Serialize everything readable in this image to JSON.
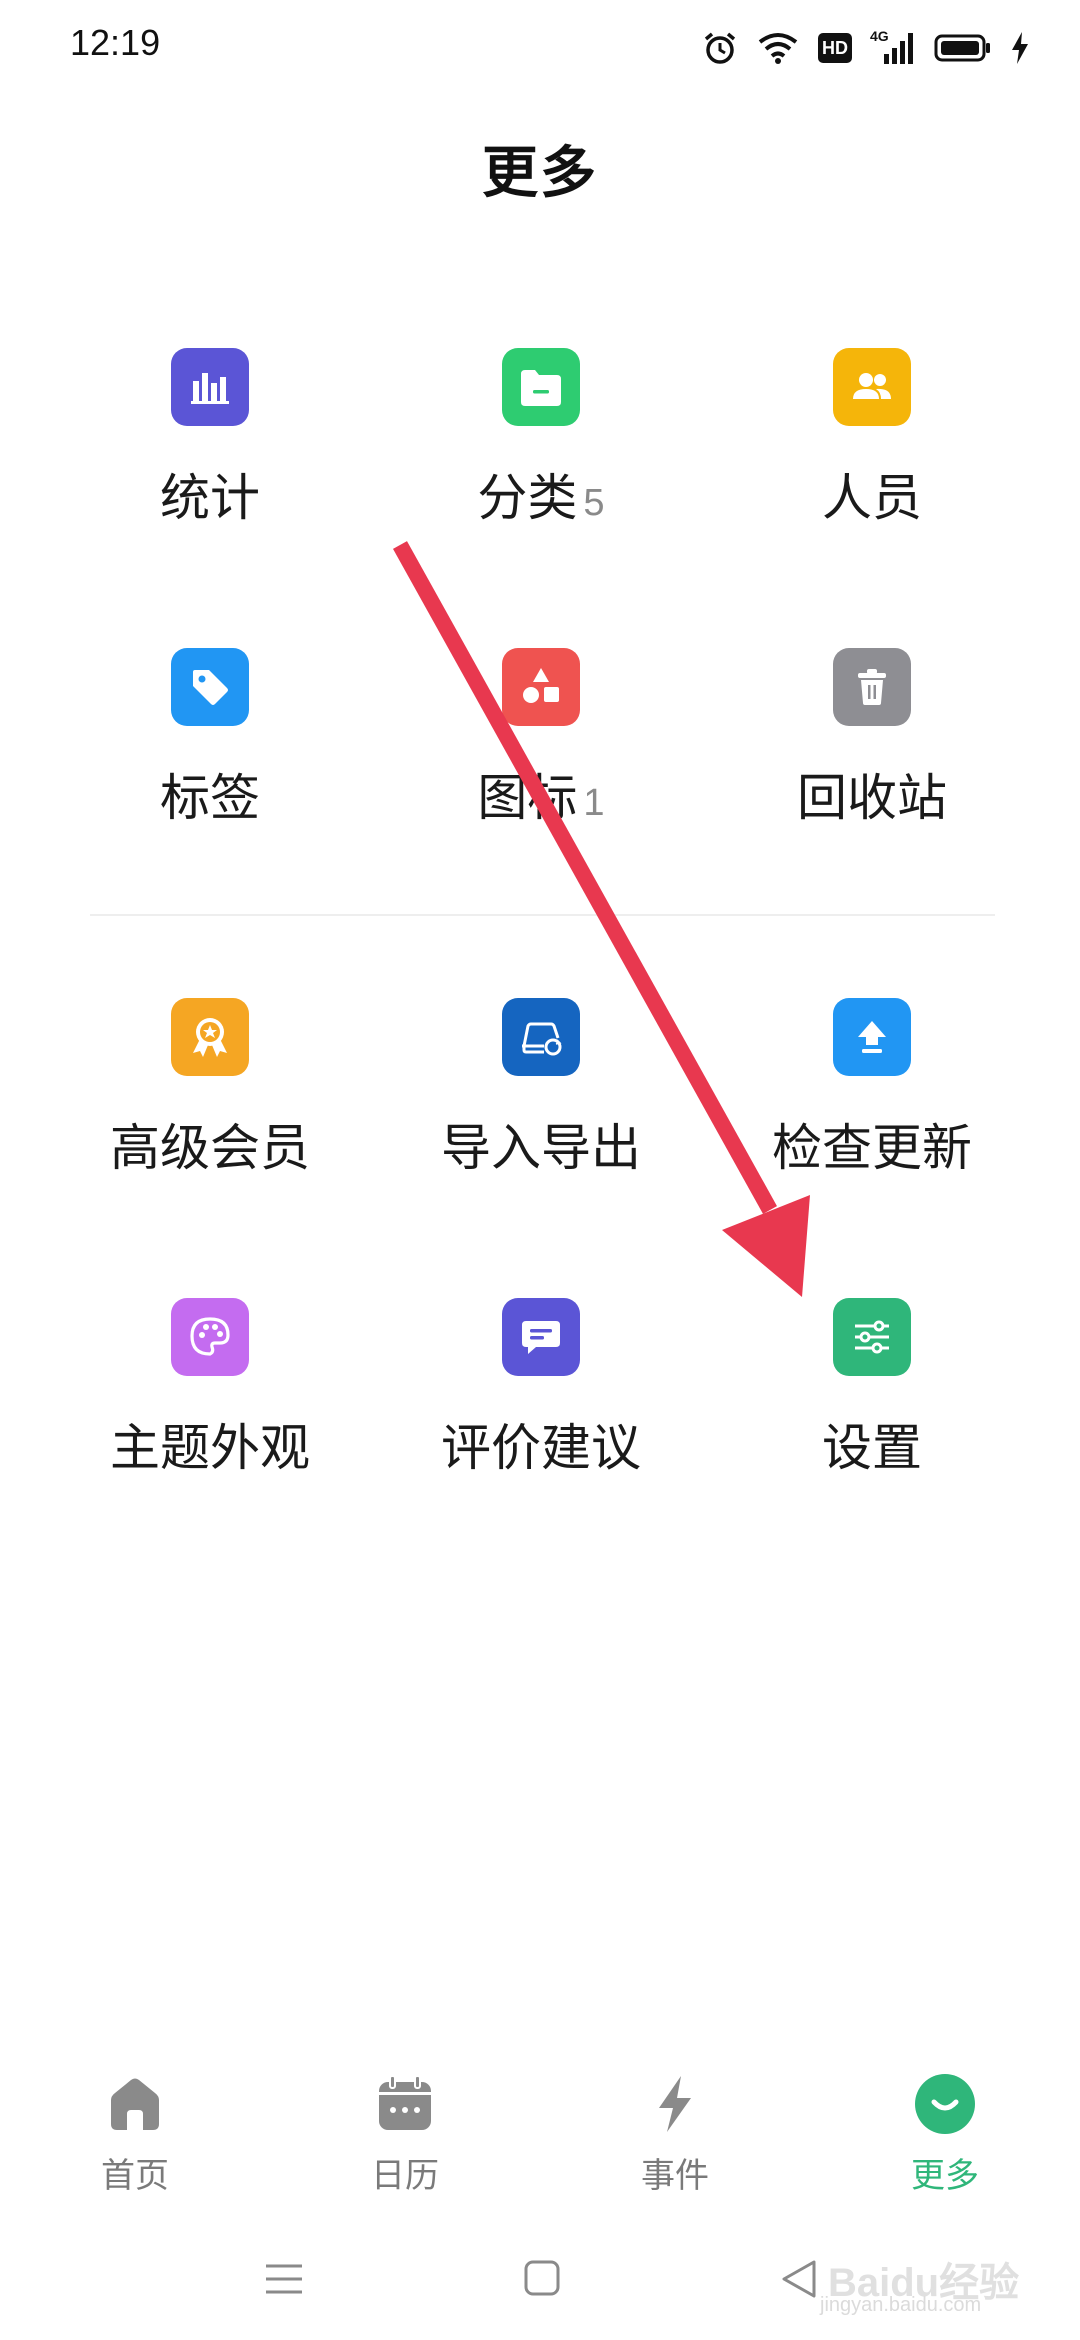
{
  "status_bar": {
    "time": "12:19",
    "icons": [
      "alarm-icon",
      "wifi-icon",
      "hd-icon",
      "4g-signal-icon",
      "battery-icon",
      "charging-icon"
    ],
    "hd_text": "HD",
    "net_text": "4G"
  },
  "header": {
    "title": "更多"
  },
  "grid_top": [
    {
      "label": "统计",
      "badge": "",
      "icon": "statistics-icon",
      "color": "#5b55d6"
    },
    {
      "label": "分类",
      "badge": "5",
      "icon": "folder-icon",
      "color": "#2ecc71"
    },
    {
      "label": "人员",
      "badge": "",
      "icon": "people-icon",
      "color": "#f5b50a"
    },
    {
      "label": "标签",
      "badge": "",
      "icon": "tag-icon",
      "color": "#2196f3"
    },
    {
      "label": "图标",
      "badge": "1",
      "icon": "shapes-icon",
      "color": "#ef5350"
    },
    {
      "label": "回收站",
      "badge": "",
      "icon": "trash-icon",
      "color": "#8e8e93"
    }
  ],
  "grid_bottom": [
    {
      "label": "高级会员",
      "badge": "",
      "icon": "vip-badge-icon",
      "color": "#f5a623"
    },
    {
      "label": "导入导出",
      "badge": "",
      "icon": "import-export-icon",
      "color": "#1565c0"
    },
    {
      "label": "检查更新",
      "badge": "",
      "icon": "update-icon",
      "color": "#2196f3"
    },
    {
      "label": "主题外观",
      "badge": "",
      "icon": "palette-icon",
      "color": "#c46cf0"
    },
    {
      "label": "评价建议",
      "badge": "",
      "icon": "feedback-icon",
      "color": "#5b55d6"
    },
    {
      "label": "设置",
      "badge": "",
      "icon": "settings-sliders-icon",
      "color": "#2fb67a"
    }
  ],
  "bottom_nav": [
    {
      "label": "首页",
      "icon": "home-icon",
      "active": false
    },
    {
      "label": "日历",
      "icon": "calendar-icon",
      "active": false
    },
    {
      "label": "事件",
      "icon": "lightning-icon",
      "active": false
    },
    {
      "label": "更多",
      "icon": "more-smile-icon",
      "active": true
    }
  ],
  "system_nav": [
    "menu-icon",
    "home-square-icon",
    "back-triangle-icon"
  ],
  "accent_color": "#2fb67a",
  "arrow_color": "#e8384f",
  "watermark": {
    "logo": "Baidu经验",
    "url": "jingyan.baidu.com"
  }
}
